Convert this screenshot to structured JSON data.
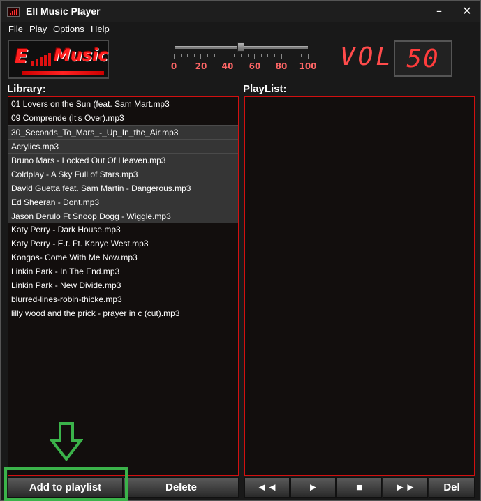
{
  "window": {
    "title": "Ell Music Player"
  },
  "menu": [
    {
      "label": "File"
    },
    {
      "label": "Play"
    },
    {
      "label": "Options"
    },
    {
      "label": "Help"
    }
  ],
  "logo": {
    "letter": "E",
    "word": "Music"
  },
  "volume": {
    "label": "VOL:",
    "value": "50",
    "level": 50,
    "ticks": [
      "0",
      "20",
      "40",
      "60",
      "80",
      "100"
    ]
  },
  "library": {
    "label": "Library:",
    "items": [
      "01 Lovers on the Sun (feat. Sam Mart.mp3",
      "09 Comprende (It's Over).mp3",
      "30_Seconds_To_Mars_-_Up_In_the_Air.mp3",
      "Acrylics.mp3",
      "Bruno Mars - Locked Out Of Heaven.mp3",
      "Coldplay - A Sky Full of Stars.mp3",
      "David Guetta feat. Sam Martin - Dangerous.mp3",
      "Ed Sheeran - Dont.mp3",
      "Jason Derulo Ft Snoop Dogg - Wiggle.mp3",
      "Katy Perry - Dark House.mp3",
      "Katy Perry - E.t. Ft. Kanye West.mp3",
      "Kongos- Come With Me Now.mp3",
      "Linkin Park - In The End.mp3",
      "Linkin Park - New Divide.mp3",
      "blurred-lines-robin-thicke.mp3",
      "lilly wood and the prick - prayer in c (cut).mp3"
    ],
    "selected": [
      2,
      3,
      4,
      5,
      6,
      7,
      8
    ]
  },
  "playlist": {
    "label": "PlayList:",
    "items": []
  },
  "buttons": {
    "add": "Add to playlist",
    "delete": "Delete",
    "prev": "◄◄",
    "play": "►",
    "stop": "■",
    "next": "►►",
    "del": "Del"
  },
  "colors": {
    "accent": "#d21010",
    "highlight": "#3bb34a"
  }
}
